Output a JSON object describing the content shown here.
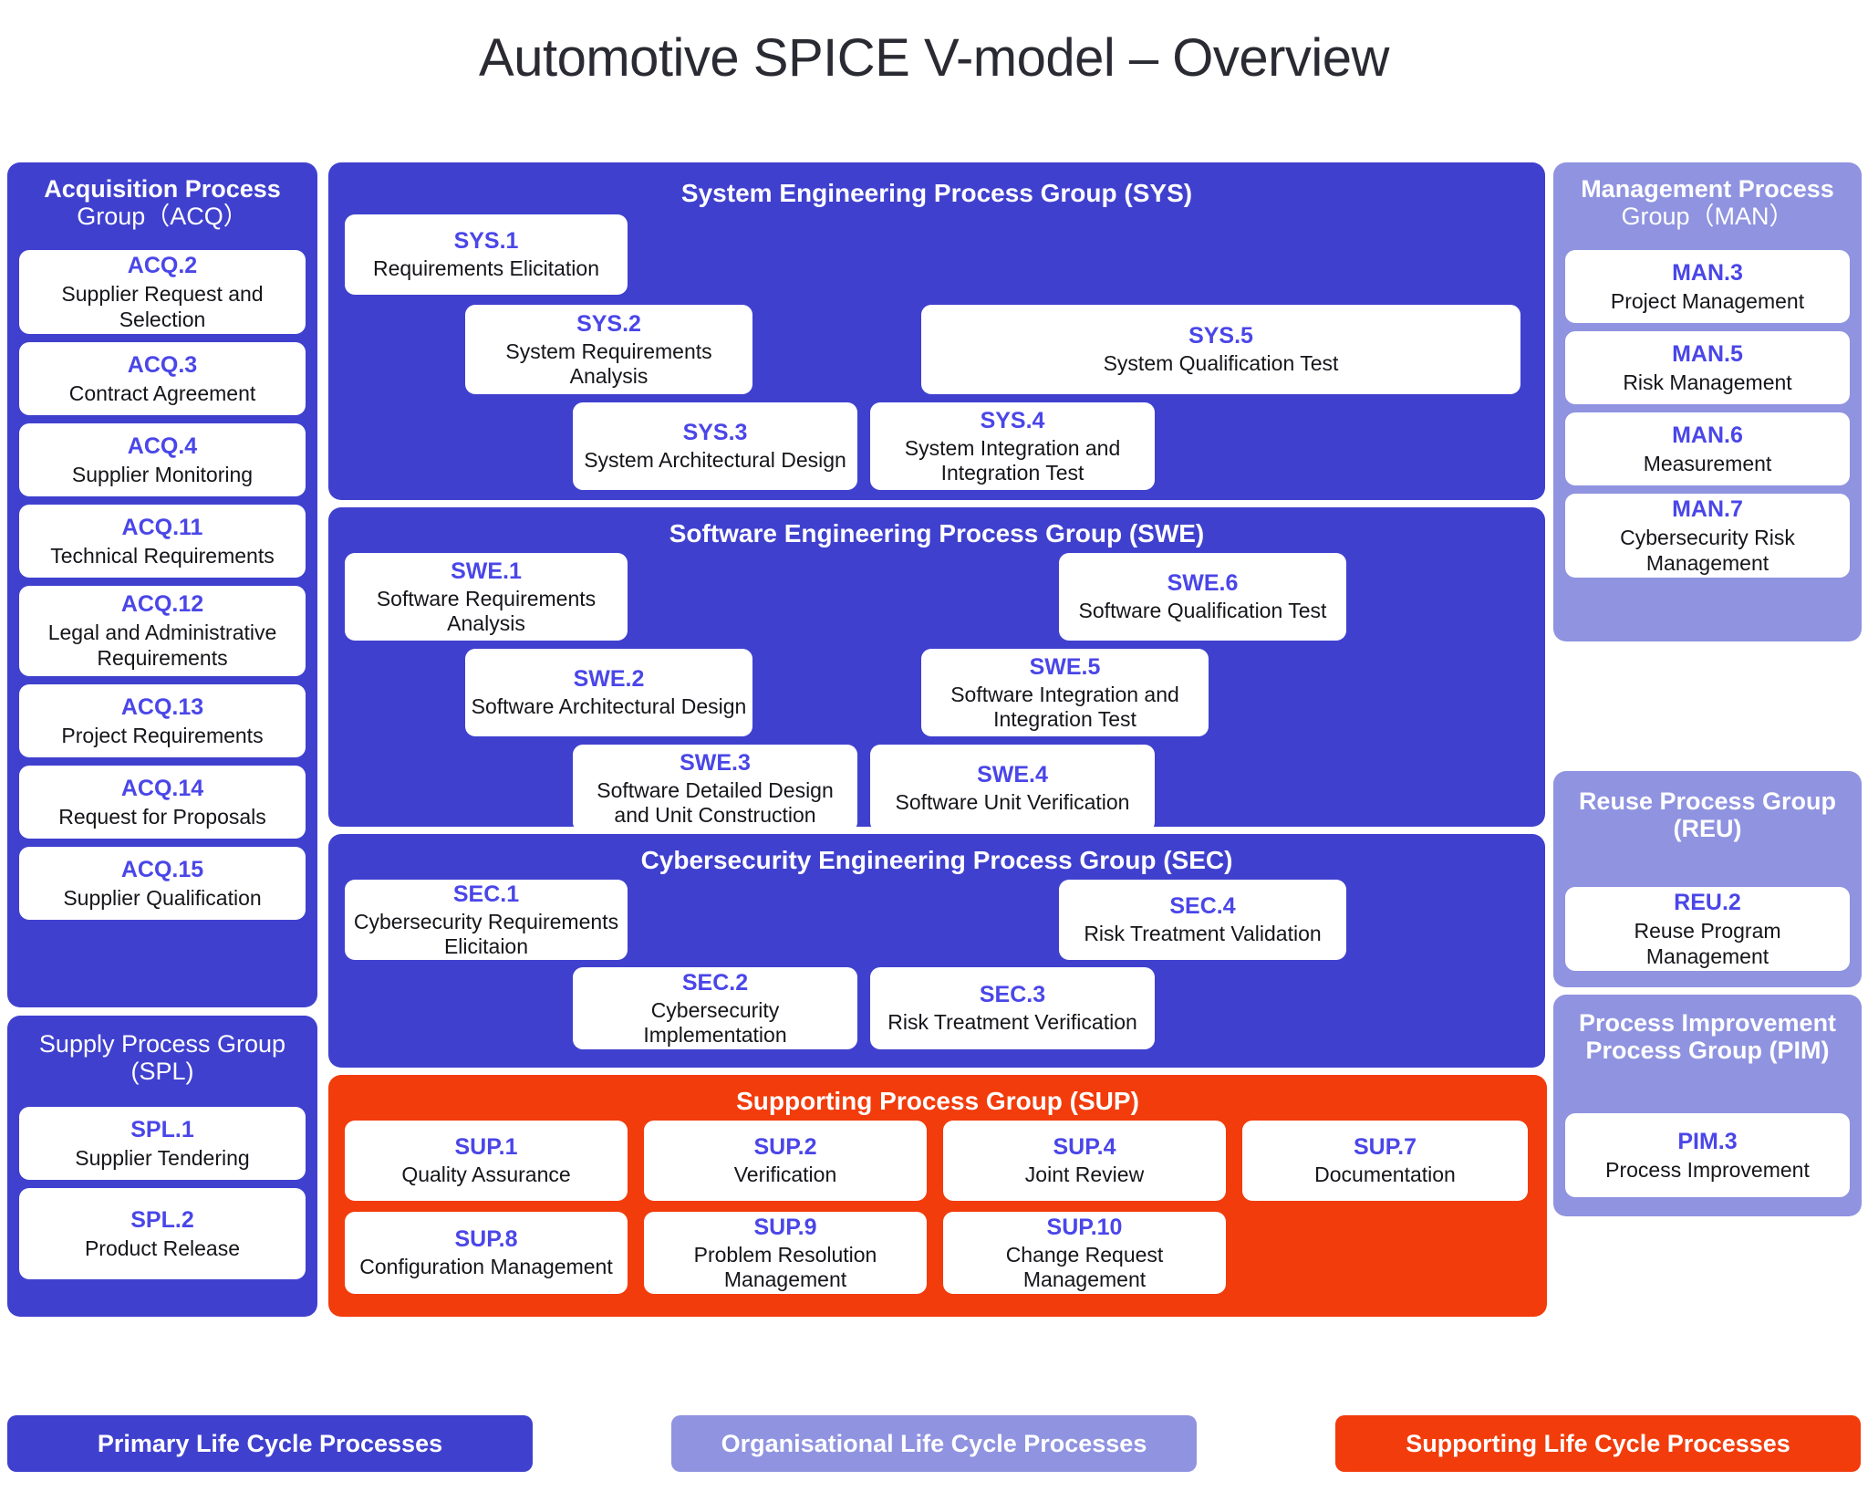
{
  "title": "Automotive SPICE V-model – Overview",
  "colors": {
    "primary": "#4040cf",
    "organisational": "#8f93e0",
    "supporting": "#f23c0c",
    "code_text": "#4a46e8",
    "card_bg": "#ffffff",
    "title_text": "#2a2a33"
  },
  "acq": {
    "group_title_line1": "Acquisition Process",
    "group_title_line2": "Group（ACQ）",
    "items": [
      {
        "code": "ACQ.2",
        "name": "Supplier Request and Selection"
      },
      {
        "code": "ACQ.3",
        "name": "Contract Agreement"
      },
      {
        "code": "ACQ.4",
        "name": "Supplier Monitoring"
      },
      {
        "code": "ACQ.11",
        "name": "Technical Requirements"
      },
      {
        "code": "ACQ.12",
        "name": "Legal and Administrative Requirements"
      },
      {
        "code": "ACQ.13",
        "name": "Project Requirements"
      },
      {
        "code": "ACQ.14",
        "name": "Request for Proposals"
      },
      {
        "code": "ACQ.15",
        "name": "Supplier Qualification"
      }
    ]
  },
  "spl": {
    "group_title_line1": "Supply Process Group",
    "group_title_line2": "(SPL)",
    "items": [
      {
        "code": "SPL.1",
        "name": "Supplier Tendering"
      },
      {
        "code": "SPL.2",
        "name": "Product Release"
      }
    ]
  },
  "sys": {
    "group_title": "System Engineering Process Group (SYS)",
    "items": [
      {
        "code": "SYS.1",
        "name": "Requirements Elicitation"
      },
      {
        "code": "SYS.2",
        "name": "System Requirements Analysis"
      },
      {
        "code": "SYS.3",
        "name": "System Architectural Design"
      },
      {
        "code": "SYS.4",
        "name": "System Integration and Integration Test"
      },
      {
        "code": "SYS.5",
        "name": "System Qualification Test"
      }
    ]
  },
  "swe": {
    "group_title": "Software Engineering Process Group (SWE)",
    "items": [
      {
        "code": "SWE.1",
        "name": "Software Requirements Analysis"
      },
      {
        "code": "SWE.2",
        "name": "Software Architectural Design"
      },
      {
        "code": "SWE.3",
        "name": "Software Detailed Design and Unit Construction"
      },
      {
        "code": "SWE.4",
        "name": "Software Unit Verification"
      },
      {
        "code": "SWE.5",
        "name": "Software Integration and Integration Test"
      },
      {
        "code": "SWE.6",
        "name": "Software Qualification Test"
      }
    ]
  },
  "sec": {
    "group_title": "Cybersecurity Engineering Process Group (SEC)",
    "items": [
      {
        "code": "SEC.1",
        "name": "Cybersecurity Requirements Elicitaion"
      },
      {
        "code": "SEC.2",
        "name": "Cybersecurity Implementation"
      },
      {
        "code": "SEC.3",
        "name": "Risk Treatment Verification"
      },
      {
        "code": "SEC.4",
        "name": "Risk Treatment Validation"
      }
    ]
  },
  "sup": {
    "group_title": "Supporting Process Group (SUP)",
    "items": [
      {
        "code": "SUP.1",
        "name": "Quality Assurance"
      },
      {
        "code": "SUP.2",
        "name": "Verification"
      },
      {
        "code": "SUP.4",
        "name": "Joint Review"
      },
      {
        "code": "SUP.7",
        "name": "Documentation"
      },
      {
        "code": "SUP.8",
        "name": "Configuration Management"
      },
      {
        "code": "SUP.9",
        "name": "Problem Resolution Management"
      },
      {
        "code": "SUP.10",
        "name": "Change Request Management"
      }
    ]
  },
  "man": {
    "group_title_line1": "Management Process",
    "group_title_line2": "Group（MAN）",
    "items": [
      {
        "code": "MAN.3",
        "name": "Project Management"
      },
      {
        "code": "MAN.5",
        "name": "Risk Management"
      },
      {
        "code": "MAN.6",
        "name": "Measurement"
      },
      {
        "code": "MAN.7",
        "name": "Cybersecurity Risk Management"
      }
    ]
  },
  "reu": {
    "group_title_line1": "Reuse Process Group",
    "group_title_line2": "(REU)",
    "items": [
      {
        "code": "REU.2",
        "name": "Reuse Program Management"
      }
    ]
  },
  "pim": {
    "group_title_line1": "Process Improvement",
    "group_title_line2": "Process Group (PIM)",
    "items": [
      {
        "code": "PIM.3",
        "name": "Process Improvement"
      }
    ]
  },
  "legend": [
    {
      "label": "Primary Life Cycle Processes",
      "color": "#4040cf"
    },
    {
      "label": "Organisational Life Cycle Processes",
      "color": "#8f93e0"
    },
    {
      "label": "Supporting Life Cycle Processes",
      "color": "#f23c0c"
    }
  ]
}
